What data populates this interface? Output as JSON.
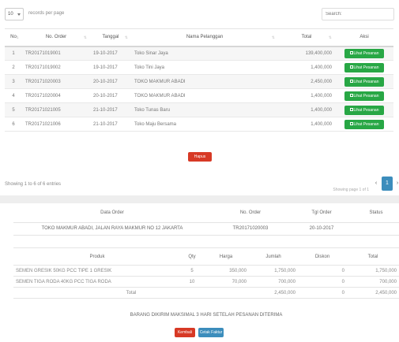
{
  "toolbar": {
    "length_value": "10",
    "length_label": "records per page",
    "search_placeholder": "Search:"
  },
  "table": {
    "headers": [
      "No",
      "No. Order",
      "Tanggal",
      "Nama Pelanggan",
      "Total",
      "Aksi"
    ],
    "rows": [
      {
        "no": "1",
        "order": "TR20171019001",
        "tanggal": "19-10-2017",
        "nama": "Toko Sinar Jaya",
        "total": "139,400,000",
        "aksi": "Lihat Pesanan"
      },
      {
        "no": "2",
        "order": "TR20171019002",
        "tanggal": "19-10-2017",
        "nama": "Toko Tini Jaya",
        "total": "1,400,000",
        "aksi": "Lihat Pesanan"
      },
      {
        "no": "3",
        "order": "TR20171020003",
        "tanggal": "20-10-2017",
        "nama": "TOKO MAKMUR ABADI",
        "total": "2,450,000",
        "aksi": "Lihat Pesanan"
      },
      {
        "no": "4",
        "order": "TR20171020004",
        "tanggal": "20-10-2017",
        "nama": "TOKO MAKMUR ABADI",
        "total": "1,400,000",
        "aksi": "Lihat Pesanan"
      },
      {
        "no": "5",
        "order": "TR20171021005",
        "tanggal": "21-10-2017",
        "nama": "Toko Tunas Baru",
        "total": "1,400,000",
        "aksi": "Lihat Pesanan"
      },
      {
        "no": "6",
        "order": "TR20171021006",
        "tanggal": "21-10-2017",
        "nama": "Toko Maju Bersama",
        "total": "1,400,000",
        "aksi": "Lihat Pesanan"
      }
    ],
    "delete_label": "Hapus"
  },
  "footer": {
    "info": "Showing 1 to 6 of 6 entries",
    "prev": "‹",
    "page": "1",
    "next": "›",
    "note": "Showing page 1 of 1"
  },
  "detail": {
    "headers": [
      "Data Order",
      "No. Order",
      "Tgl Order",
      "Status"
    ],
    "values": [
      "TOKO MAKMUR ABADI, JALAN RAYA MAKMUR NO 12 JAKARTA",
      "TR20171020003",
      "20-10-2017",
      ""
    ],
    "item_headers": [
      "Produk",
      "Qty",
      "Harga",
      "Jumlah",
      "Diskon",
      "Total"
    ],
    "items": [
      {
        "produk": "SEMEN GRESIK 50KG PCC TIPE 1 GRESIK",
        "qty": "5",
        "harga": "350,000",
        "jumlah": "1,750,000",
        "diskon": "0",
        "total": "1,750,000"
      },
      {
        "produk": "SEMEN TIGA RODA 40KG PCC TIGA RODA",
        "qty": "10",
        "harga": "70,000",
        "jumlah": "700,000",
        "diskon": "0",
        "total": "700,000"
      }
    ],
    "total_label": "Total",
    "total_jumlah": "2,450,000",
    "total_diskon": "0",
    "total_value": "2,450,000",
    "note": "BARANG DIKIRIM MAKSIMAL 3 HARI SETELAH PESANAN DITERIMA",
    "back_label": "Kembali",
    "print_label": "Cetak Faktur"
  }
}
